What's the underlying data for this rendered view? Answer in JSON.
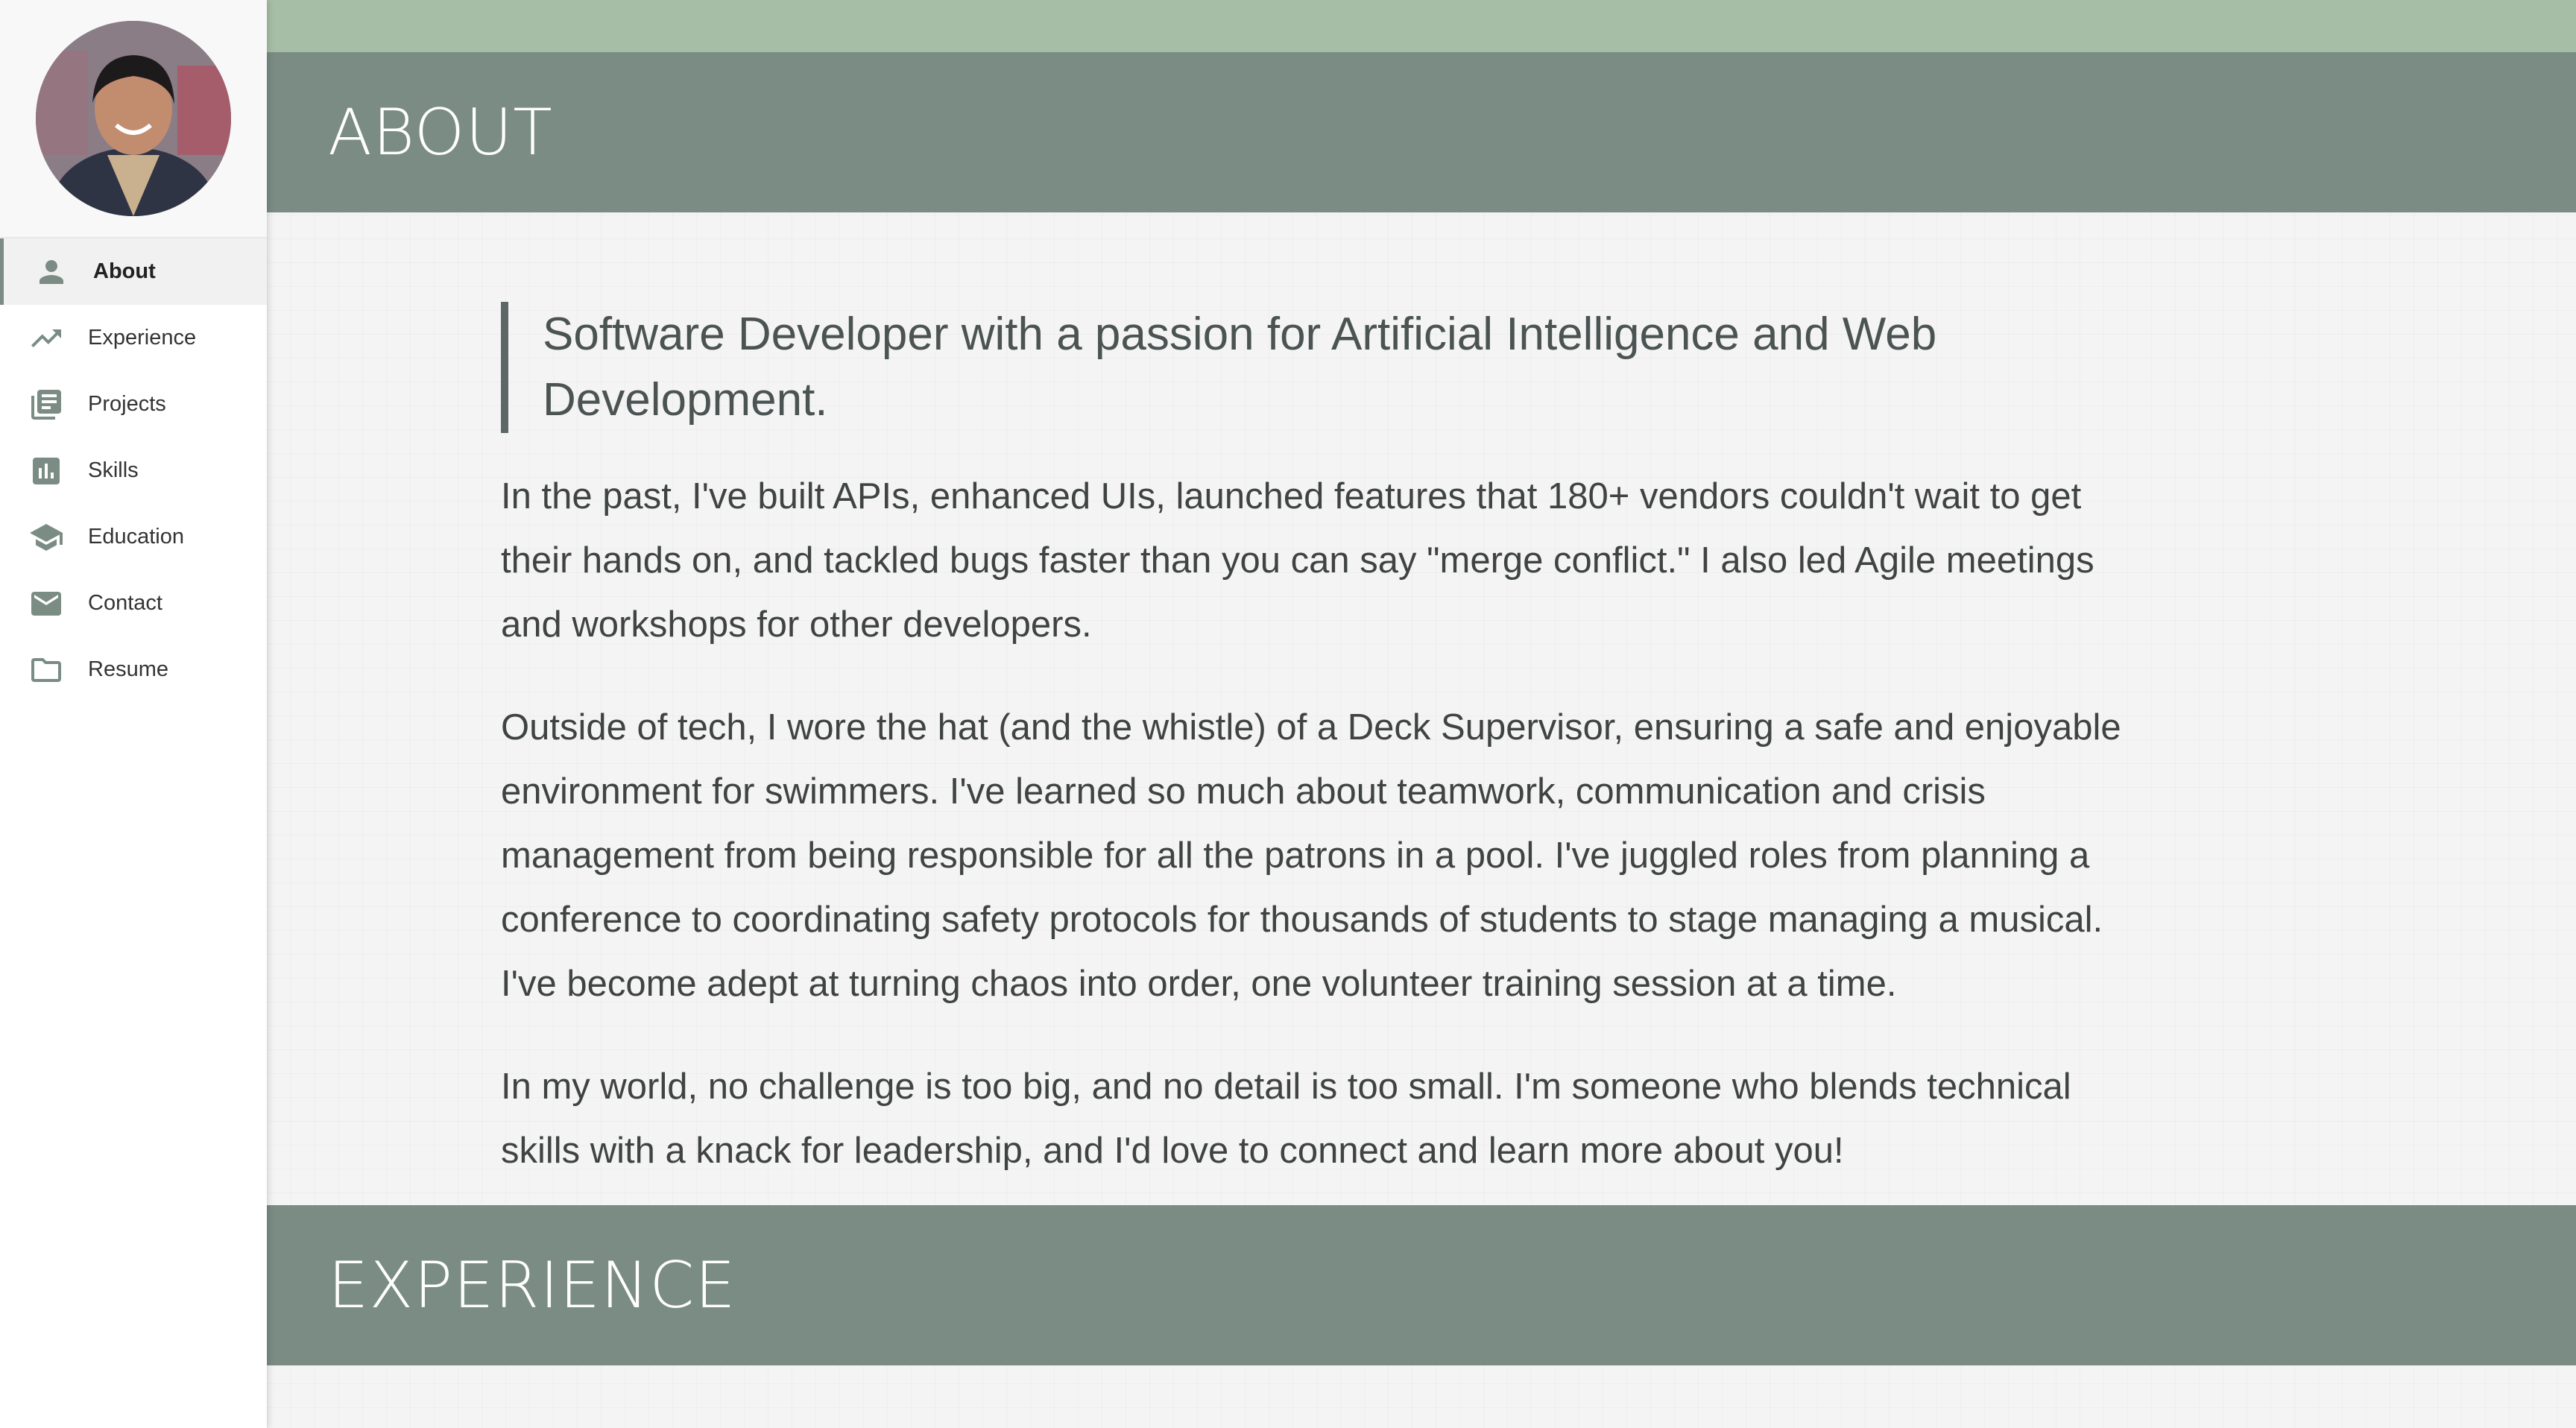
{
  "sidebar": {
    "avatar_alt": "Profile photo",
    "items": [
      {
        "label": "About",
        "icon": "person-icon",
        "active": true
      },
      {
        "label": "Experience",
        "icon": "trending-up-icon",
        "active": false
      },
      {
        "label": "Projects",
        "icon": "library-books-icon",
        "active": false
      },
      {
        "label": "Skills",
        "icon": "bar-chart-icon",
        "active": false
      },
      {
        "label": "Education",
        "icon": "graduation-cap-icon",
        "active": false
      },
      {
        "label": "Contact",
        "icon": "mail-icon",
        "active": false
      },
      {
        "label": "Resume",
        "icon": "folder-icon",
        "active": false
      }
    ]
  },
  "about": {
    "title": "ABOUT",
    "tagline": "Software Developer with a passion for Artificial Intelligence and Web Development.",
    "paragraphs": [
      "In the past, I've built APIs, enhanced UIs, launched features that 180+ vendors couldn't wait to get their hands on, and tackled bugs faster than you can say \"merge conflict.\" I also led Agile meetings and workshops for other developers.",
      "Outside of tech, I wore the hat (and the whistle) of a Deck Supervisor, ensuring a safe and enjoyable environment for swimmers. I've learned so much about teamwork, communication and crisis management from being responsible for all the patrons in a pool. I've juggled roles from planning a conference to coordinating safety protocols for thousands of students to stage managing a musical. I've become adept at turning chaos into order, one volunteer training session at a time.",
      "In my world, no challenge is too big, and no detail is too small. I'm someone who blends technical skills with a knack for leadership, and I'd love to connect and learn more about you!"
    ]
  },
  "experience": {
    "title": "EXPERIENCE"
  },
  "colors": {
    "accent_green": "#a7bea6",
    "banner_gray_green": "#7a8c84",
    "page_bg": "#f4f4f4"
  }
}
